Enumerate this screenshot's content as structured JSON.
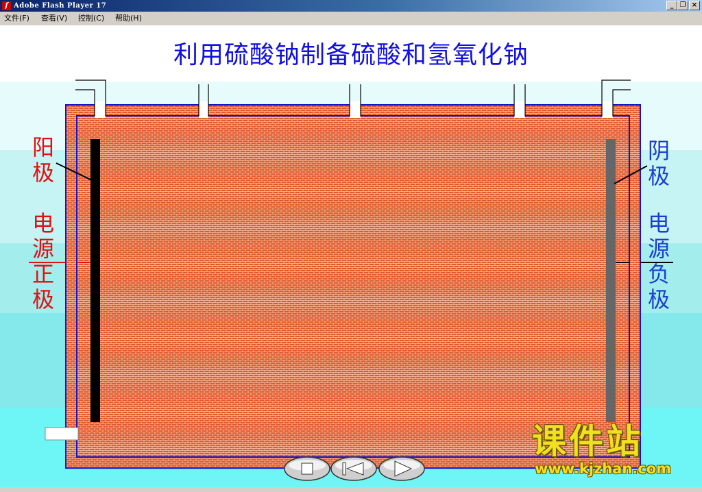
{
  "window": {
    "title": "Adobe Flash Player 17",
    "icon": "flash-icon",
    "buttons": {
      "minimize": "_",
      "restore": "❐",
      "close": "×"
    }
  },
  "menu": {
    "items": [
      "文件(F)",
      "查看(V)",
      "控制(C)",
      "帮助(H)"
    ]
  },
  "slide": {
    "title": "利用硫酸钠制备硫酸和氢氧化钠",
    "anode_label_1": "阳",
    "anode_label_2": "极",
    "positive_label": [
      "电",
      "源",
      "正",
      "极"
    ],
    "cathode_label_1": "阴",
    "cathode_label_2": "极",
    "negative_label": [
      "电",
      "源",
      "负",
      "极"
    ]
  },
  "controls": {
    "stop": "stop-icon",
    "rewind": "rewind-icon",
    "play": "play-icon"
  },
  "watermark": {
    "name": "课件站",
    "url": "www.kjzhan.com"
  },
  "colors": {
    "title_blue": "#1010e0",
    "brick": "#e05a2a",
    "wall_outline": "#1414c8",
    "anode": "#000000",
    "cathode": "#666666",
    "positive_red": "#e01010",
    "negative_blue": "#1a3fd0",
    "watermark_yellow": "#f0e020"
  }
}
